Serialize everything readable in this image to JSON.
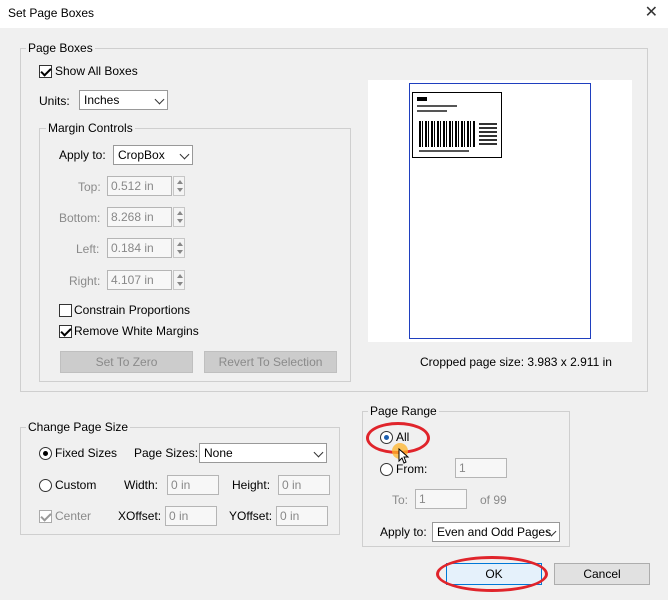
{
  "window": {
    "title": "Set Page Boxes",
    "close": "✕"
  },
  "page_boxes": {
    "legend": "Page Boxes",
    "show_all_boxes": "Show All Boxes",
    "units_label": "Units:",
    "units_value": "Inches"
  },
  "margin_controls": {
    "legend": "Margin Controls",
    "apply_to_label": "Apply to:",
    "apply_to_value": "CropBox",
    "top_label": "Top:",
    "top_value": "0.512 in",
    "bottom_label": "Bottom:",
    "bottom_value": "8.268 in",
    "left_label": "Left:",
    "left_value": "0.184 in",
    "right_label": "Right:",
    "right_value": "4.107 in",
    "constrain": "Constrain Proportions",
    "remove_white": "Remove White Margins",
    "set_to_zero": "Set To Zero",
    "revert": "Revert To Selection"
  },
  "preview": {
    "cropped_size": "Cropped page size: 3.983 x 2.911 in"
  },
  "change_page_size": {
    "legend": "Change Page Size",
    "fixed_sizes": "Fixed Sizes",
    "page_sizes_label": "Page Sizes:",
    "page_sizes_value": "None",
    "custom": "Custom",
    "width_label": "Width:",
    "width_value": "0 in",
    "height_label": "Height:",
    "height_value": "0 in",
    "center": "Center",
    "xoffset_label": "XOffset:",
    "xoffset_value": "0 in",
    "yoffset_label": "YOffset:",
    "yoffset_value": "0 in"
  },
  "page_range": {
    "legend": "Page Range",
    "all": "All",
    "from_label": "From:",
    "from_value": "1",
    "to_label": "To:",
    "to_value": "1",
    "of_total": "of 99",
    "apply_to_label": "Apply to:",
    "apply_to_value": "Even and Odd Pages"
  },
  "buttons": {
    "ok": "OK",
    "cancel": "Cancel"
  },
  "colors": {
    "highlight": "#e0242b",
    "accent": "#1c5fb0"
  }
}
